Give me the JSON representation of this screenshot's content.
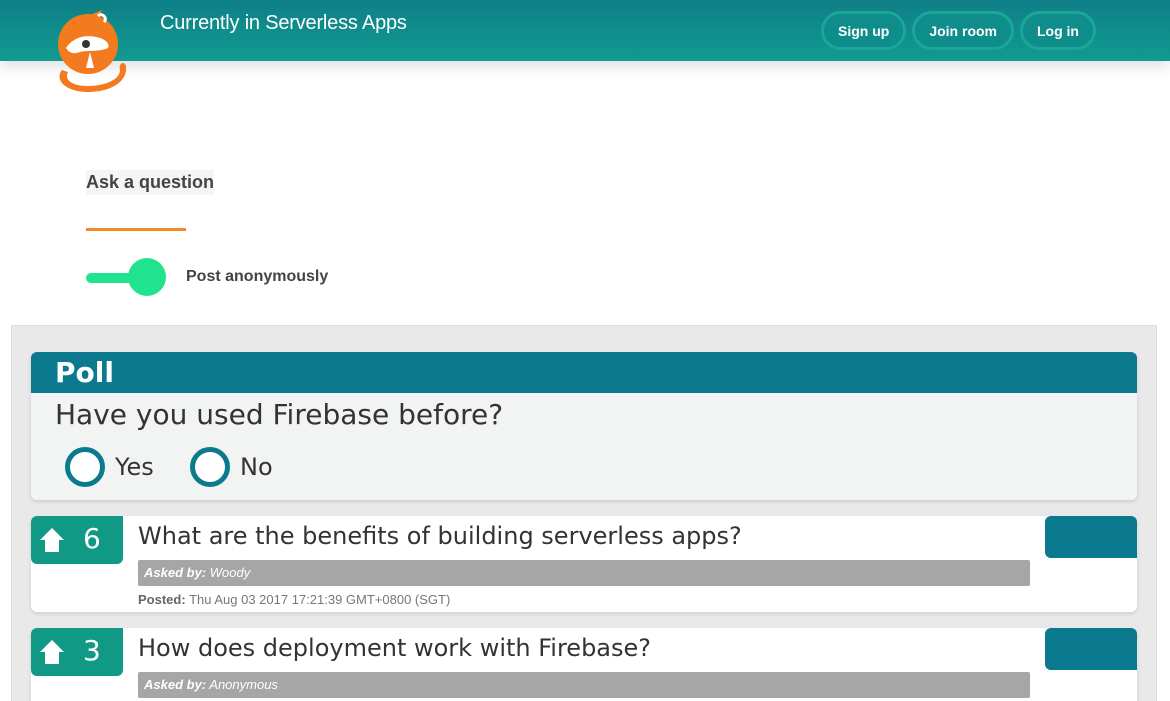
{
  "header": {
    "title": "Currently in Serverless Apps",
    "nav": [
      "Sign up",
      "Join room",
      "Log in"
    ],
    "logo_icon": "fox-logo-icon"
  },
  "ask": {
    "title": "Ask a question",
    "anonymous_label": "Post anonymously",
    "anonymous_on": true
  },
  "poll": {
    "heading": "Poll",
    "question": "Have you used Firebase before?",
    "options": [
      "Yes",
      "No"
    ]
  },
  "questions": [
    {
      "votes": "6",
      "text": "What are the benefits of building serverless apps?",
      "asked_label": "Asked by:",
      "asked_by": "Woody",
      "posted_label": "Posted:",
      "posted": "Thu Aug 03 2017 17:21:39 GMT+0800 (SGT)"
    },
    {
      "votes": "3",
      "text": "How does deployment work with Firebase?",
      "asked_label": "Asked by:",
      "asked_by": "Anonymous"
    }
  ],
  "colors": {
    "header": "#0e7f87",
    "accent": "#0b7a8f",
    "vote": "#109985",
    "toggle": "#21e38f",
    "underline": "#f08a24"
  }
}
